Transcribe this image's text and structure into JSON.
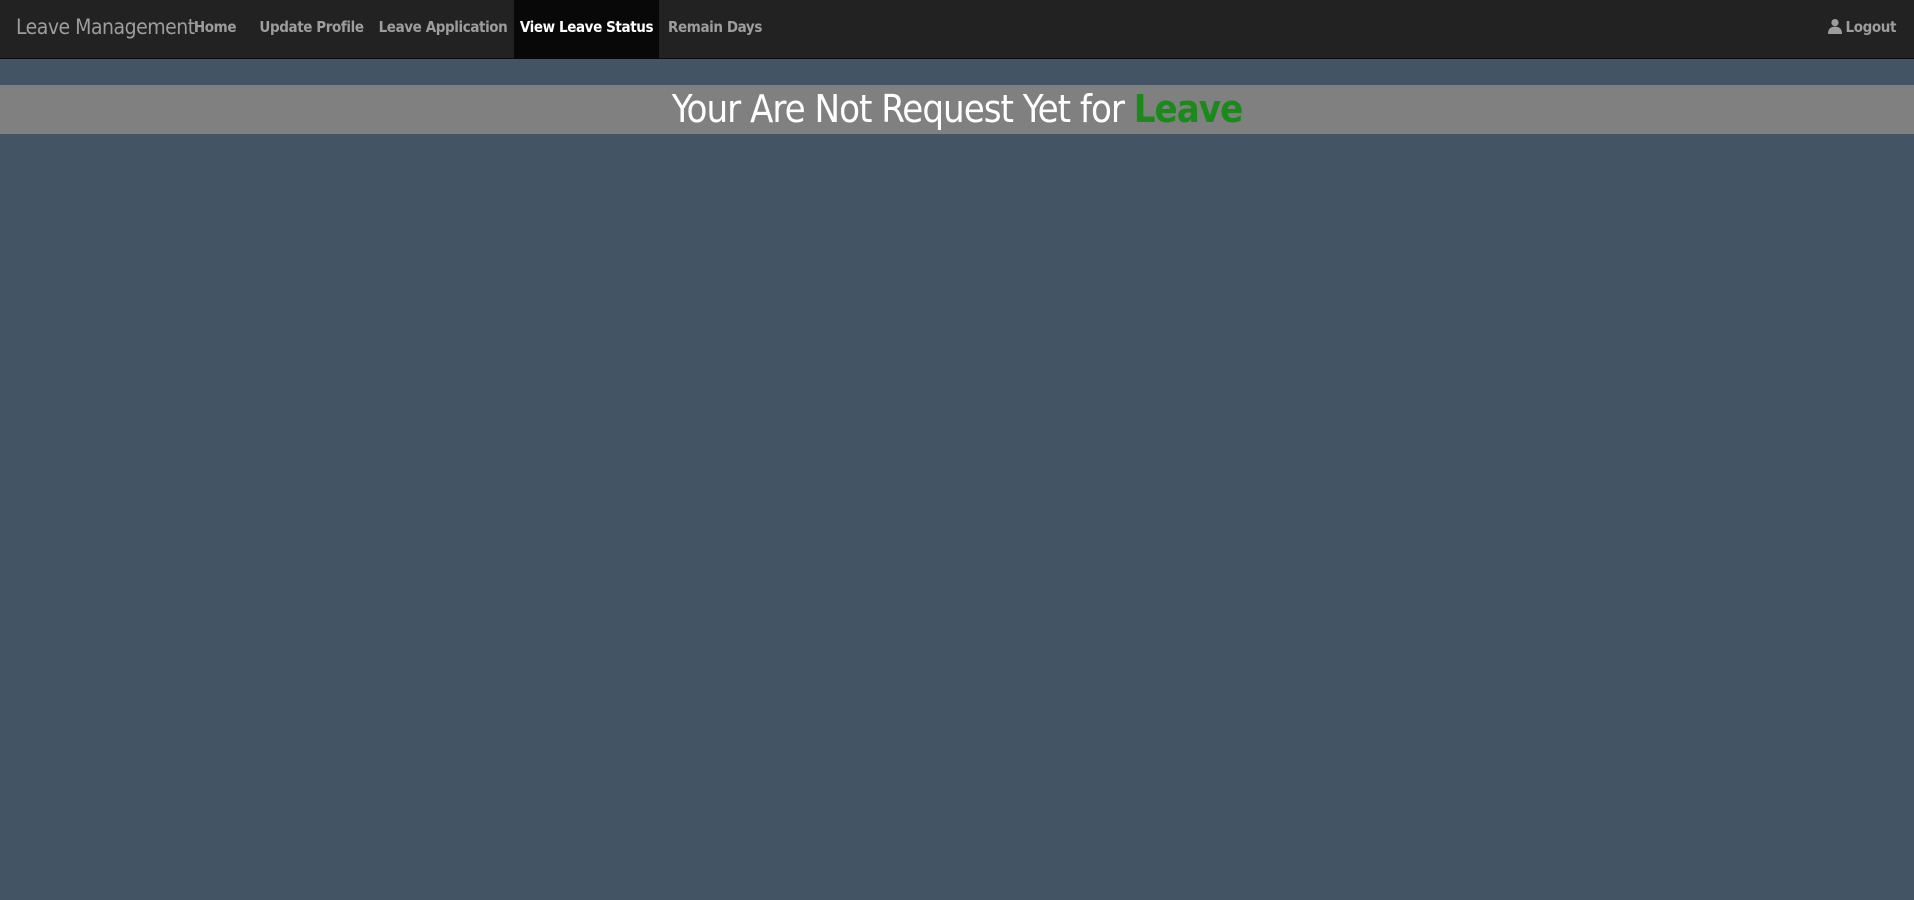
{
  "navbar": {
    "brand": "Leave Management",
    "items": [
      {
        "label": "Home",
        "active": false
      },
      {
        "label": "Update Profile",
        "active": false
      },
      {
        "label": "Leave Application",
        "active": false
      },
      {
        "label": "View Leave Status",
        "active": true
      },
      {
        "label": "Remain Days",
        "active": false
      }
    ],
    "logout_label": "Logout",
    "logout_icon": "user-icon"
  },
  "main": {
    "message_prefix": "Your Are Not Request Yet for",
    "message_highlight": "Leave"
  },
  "colors": {
    "page_background": "#435465",
    "navbar_background": "#222222",
    "active_tab_background": "#080808",
    "banner_background": "#808080",
    "highlight": "#1a8a1a"
  }
}
